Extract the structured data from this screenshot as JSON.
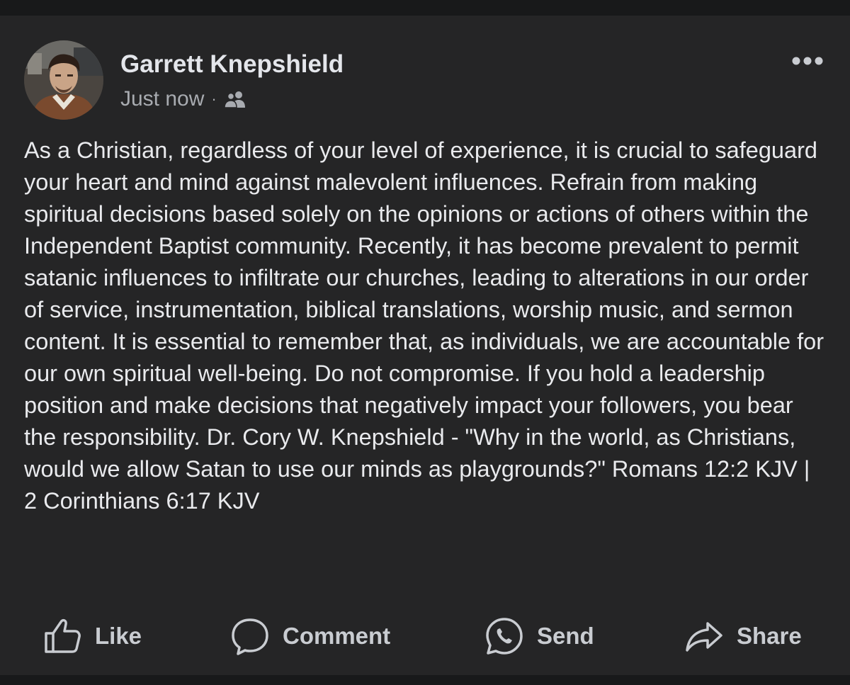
{
  "post": {
    "author_name": "Garrett Knepshield",
    "timestamp": "Just now",
    "separator": "·",
    "audience_icon": "friends-icon",
    "more_icon": "more-icon",
    "body": "As a Christian, regardless of your level of experience, it is crucial to safeguard your heart and mind against malevolent influences. Refrain from making spiritual decisions based solely on the opinions or actions of others within the Independent Baptist community. Recently, it has become prevalent to permit satanic influences to infiltrate our churches, leading to alterations in our order of service, instrumentation, biblical translations, worship music, and sermon content. It is essential to remember that, as individuals, we are accountable for our own spiritual well-being. Do not compromise. If you hold a leadership position and make decisions that negatively impact your followers, you bear the responsibility. Dr. Cory W. Knepshield - \"Why in the world, as Christians, would we allow Satan to use our minds as playgrounds?\" Romans 12:2 KJV | 2 Corinthians 6:17 KJV"
  },
  "actions": {
    "like_label": "Like",
    "comment_label": "Comment",
    "send_label": "Send",
    "share_label": "Share"
  },
  "colors": {
    "background": "#18191a",
    "card": "#252526",
    "primary_text": "#e9eaed",
    "secondary_text": "#a8abb0",
    "action_text": "#c9ccd1"
  }
}
